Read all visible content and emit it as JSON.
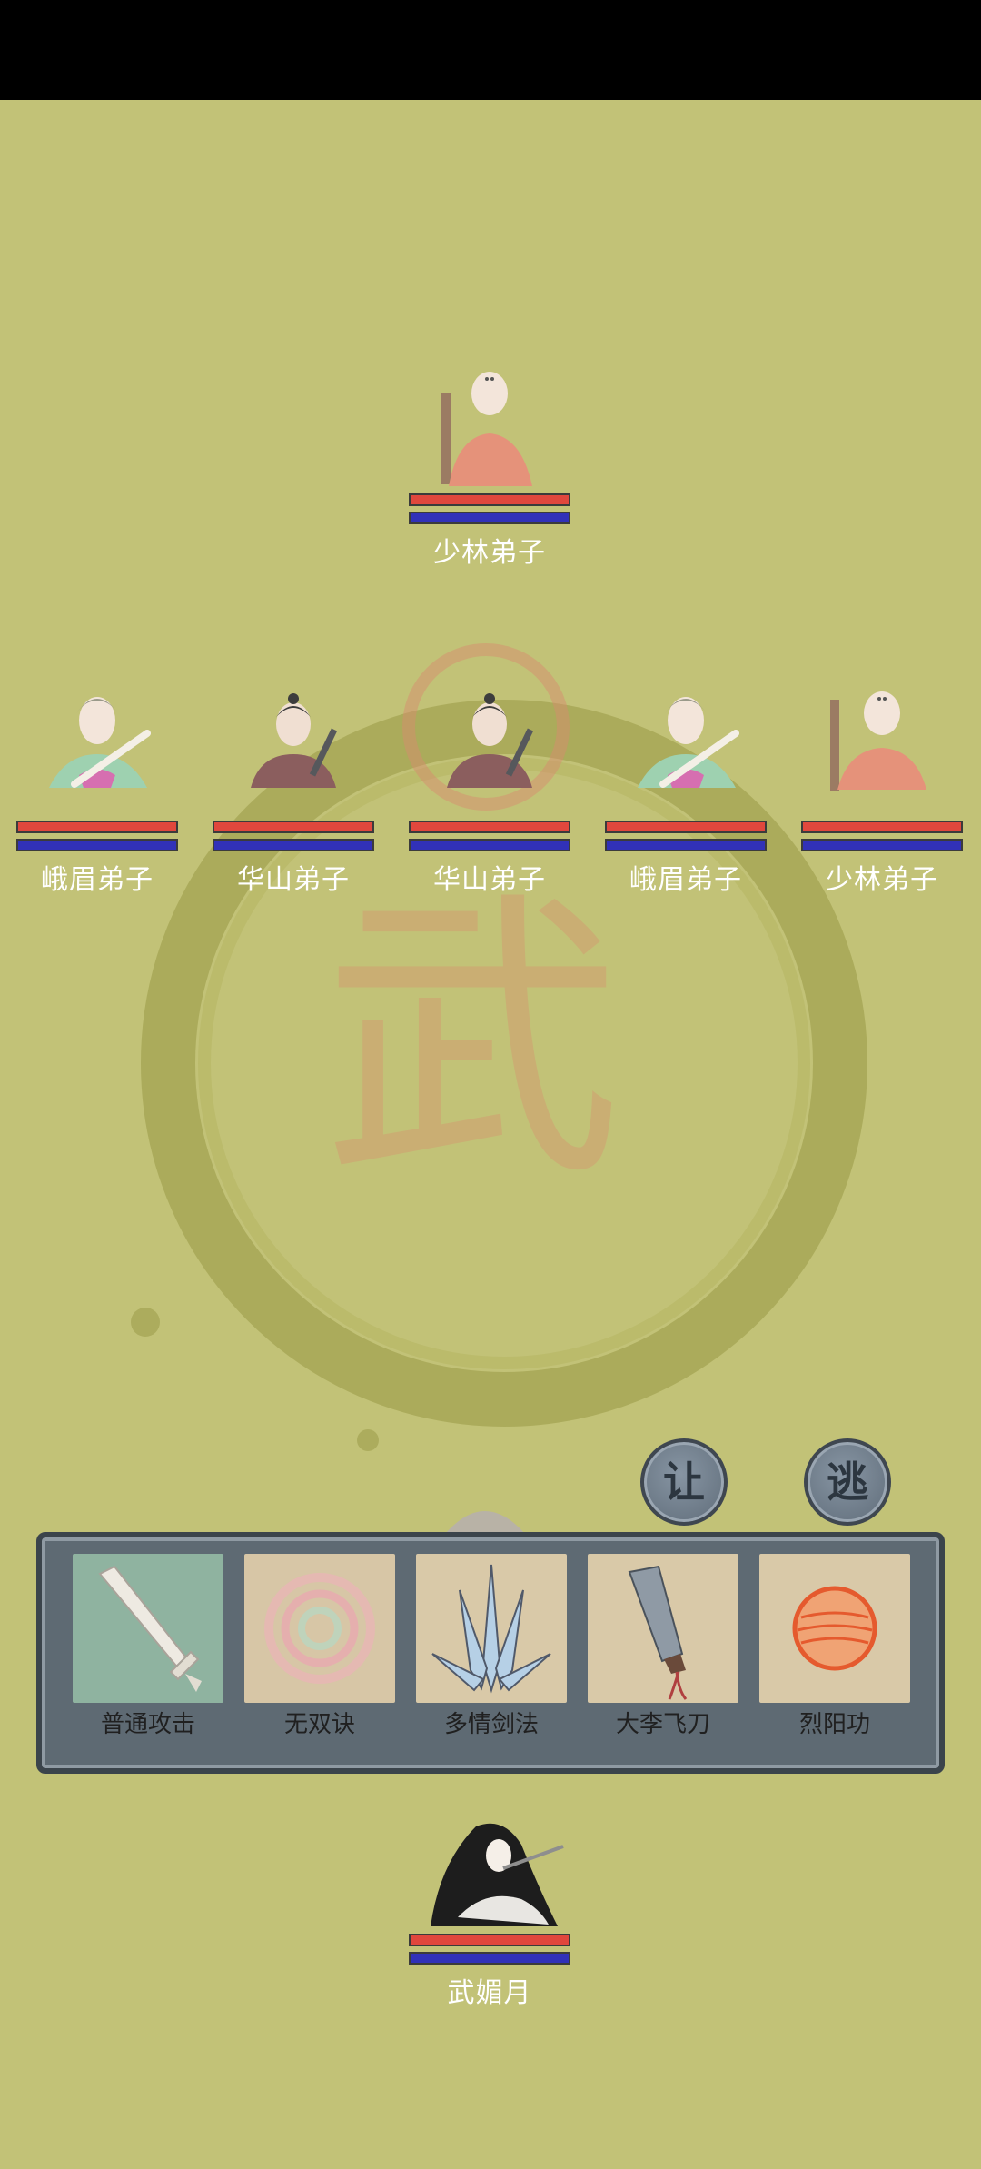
{
  "enemies": [
    {
      "name": "少林弟子",
      "sect": "shaolin",
      "hp": 1.0,
      "mp": 1.0
    },
    {
      "name": "峨眉弟子",
      "sect": "emei",
      "hp": 1.0,
      "mp": 1.0
    },
    {
      "name": "华山弟子",
      "sect": "huashan",
      "hp": 1.0,
      "mp": 1.0
    },
    {
      "name": "华山弟子",
      "sect": "huashan",
      "hp": 1.0,
      "mp": 1.0
    },
    {
      "name": "峨眉弟子",
      "sect": "emei",
      "hp": 1.0,
      "mp": 1.0
    },
    {
      "name": "少林弟子",
      "sect": "shaolin",
      "hp": 1.0,
      "mp": 1.0
    }
  ],
  "actions": {
    "yield_label": "让",
    "flee_label": "逃"
  },
  "skills": [
    {
      "name": "普通攻击",
      "icon": "sword-icon"
    },
    {
      "name": "无双诀",
      "icon": "swirl-icon"
    },
    {
      "name": "多情剑法",
      "icon": "blades-icon"
    },
    {
      "name": "大李飞刀",
      "icon": "flying-knife-icon"
    },
    {
      "name": "烈阳功",
      "icon": "sun-orb-icon"
    }
  ],
  "player": {
    "name": "武媚月",
    "hp": 1.0,
    "mp": 1.0
  },
  "background": {
    "emblem_char": "武"
  },
  "colors": {
    "background": "#c2c277",
    "hp": "#e0473d",
    "mp": "#3131b8",
    "panel": "#5e6a73"
  }
}
